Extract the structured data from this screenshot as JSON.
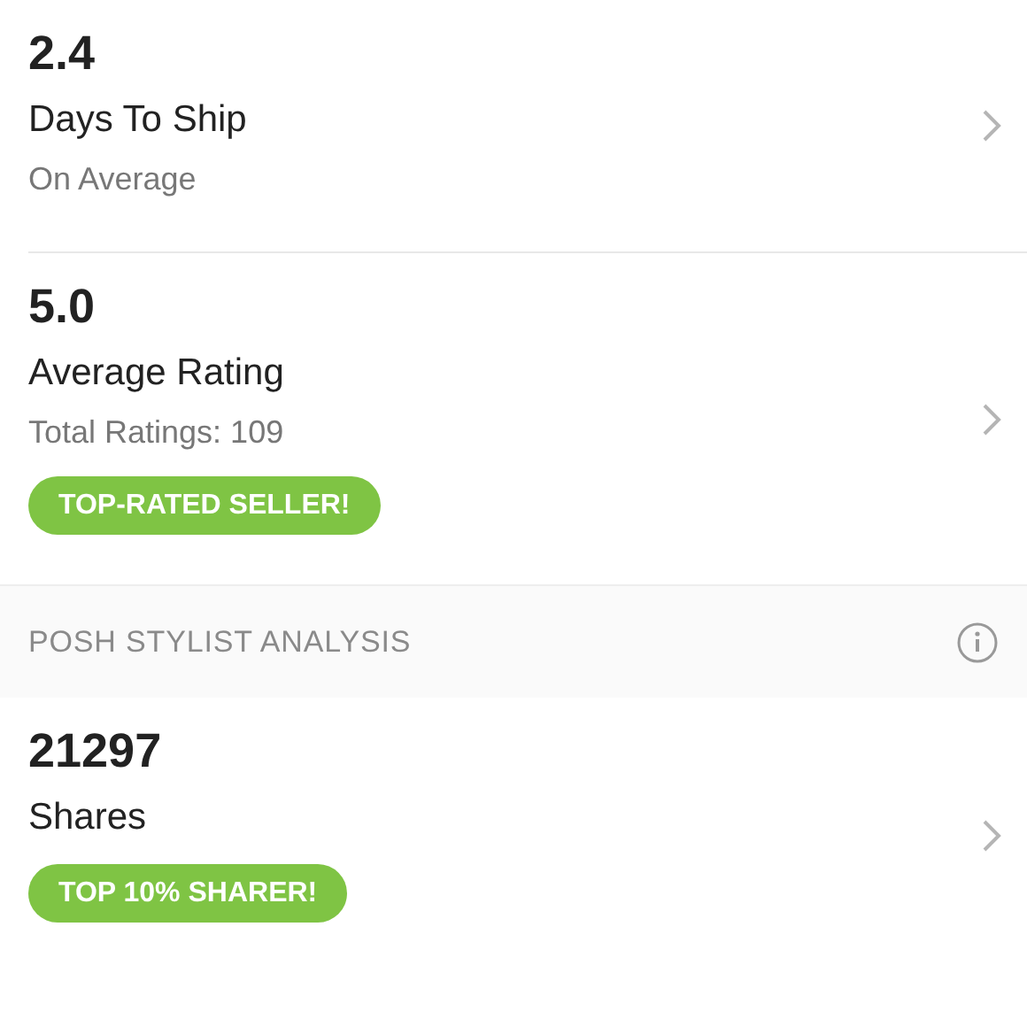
{
  "stats": [
    {
      "value": "2.4",
      "title": "Days To Ship",
      "subtitle": "On Average"
    },
    {
      "value": "5.0",
      "title": "Average Rating",
      "subtitle": "Total Ratings: 109",
      "badge": "TOP-RATED SELLER!"
    }
  ],
  "section": {
    "title": "POSH STYLIST ANALYSIS",
    "stats": [
      {
        "value": "21297",
        "title": "Shares",
        "badge": "TOP 10% SHARER!"
      }
    ]
  }
}
